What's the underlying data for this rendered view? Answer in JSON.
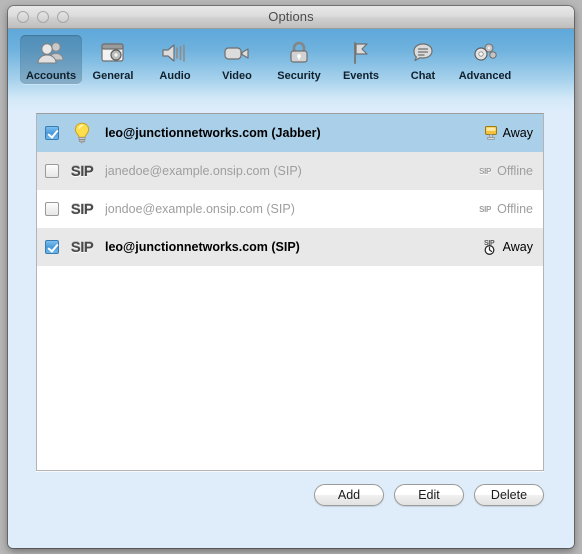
{
  "window": {
    "title": "Options",
    "traffic_lights": [
      "close-button",
      "minimize-button",
      "zoom-button"
    ]
  },
  "toolbar": {
    "items": [
      {
        "label": "Accounts",
        "icon": "accounts-icon",
        "selected": true
      },
      {
        "label": "General",
        "icon": "general-icon",
        "selected": false
      },
      {
        "label": "Audio",
        "icon": "audio-icon",
        "selected": false
      },
      {
        "label": "Video",
        "icon": "video-icon",
        "selected": false
      },
      {
        "label": "Security",
        "icon": "security-icon",
        "selected": false
      },
      {
        "label": "Events",
        "icon": "events-icon",
        "selected": false
      },
      {
        "label": "Chat",
        "icon": "chat-icon",
        "selected": false
      },
      {
        "label": "Advanced",
        "icon": "advanced-icon",
        "selected": false
      }
    ]
  },
  "accounts": [
    {
      "checked": true,
      "enabled": true,
      "selected": true,
      "type_icon": "lightbulb-icon",
      "label": "leo@junctionnetworks.com (Jabber)",
      "status": "Away",
      "status_icon": "jabber-away-icon"
    },
    {
      "checked": false,
      "enabled": false,
      "selected": false,
      "type_icon": "sip-icon",
      "label": "janedoe@example.onsip.com (SIP)",
      "status": "Offline",
      "status_icon": "sip-offline-icon"
    },
    {
      "checked": false,
      "enabled": false,
      "selected": false,
      "type_icon": "sip-icon",
      "label": "jondoe@example.onsip.com (SIP)",
      "status": "Offline",
      "status_icon": "sip-offline-icon"
    },
    {
      "checked": true,
      "enabled": true,
      "selected": false,
      "type_icon": "sip-icon",
      "label": "leo@junctionnetworks.com (SIP)",
      "status": "Away",
      "status_icon": "sip-away-icon"
    }
  ],
  "buttons": {
    "add": "Add",
    "edit": "Edit",
    "delete": "Delete"
  },
  "colors": {
    "selection_blue": "#aacfe9",
    "toolbar_blue_top": "#5ea8da",
    "content_background": "#dfedfa",
    "row_alt": "#e8e8e8"
  }
}
